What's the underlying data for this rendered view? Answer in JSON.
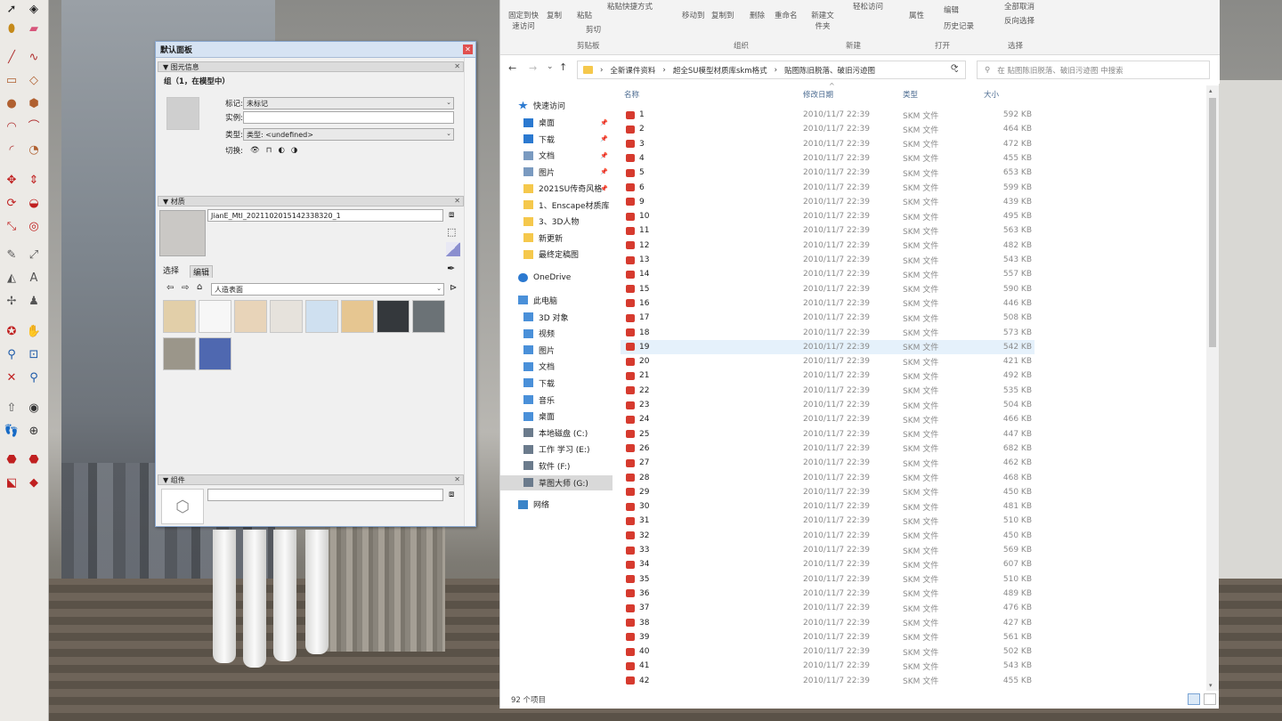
{
  "panel": {
    "title": "默认面板",
    "entity_info": {
      "header": "图元信息",
      "summary": "组（1，在模型中）",
      "tag_label": "标记:",
      "tag_value": "未标记",
      "instance_label": "实例:",
      "instance_value": "",
      "type_label": "类型:",
      "type_value": "类型: <undefined>",
      "toggle_label": "切换:"
    },
    "materials": {
      "header": "材质",
      "name_value": "JianE_Mtl_20211020151423383​20_1",
      "tab_select": "选择",
      "tab_edit": "编辑",
      "library_value": "人造表面",
      "swatch_colors": [
        "#e2cfa9",
        "#f7f7f7",
        "#e8d4b9",
        "#e6e2dc",
        "#cfe0f0",
        "#e6c691",
        "#34383c",
        "#6b7276",
        "#9b968a",
        "#4f68b0"
      ]
    },
    "components": {
      "header": "组件"
    }
  },
  "explorer": {
    "ribbon": {
      "pin_label": "固定到快速访问",
      "copy_label": "复制",
      "paste_label": "粘贴",
      "paste_shortcut_label": "粘贴快捷方式",
      "cut_label": "剪切",
      "clipboard_group": "剪贴板",
      "move_to_label": "移动到",
      "copy_to_label": "复制到",
      "delete_label": "删除",
      "rename_label": "重命名",
      "organize_group": "组织",
      "new_folder_label": "新建文件夹",
      "easy_access_label": "轻松访问",
      "new_group": "新建",
      "properties_label": "属性",
      "edit_label": "编辑",
      "history_label": "历史记录",
      "open_group": "打开",
      "select_all_label": "全部取消",
      "invert_label": "反向选择",
      "select_group": "选择"
    },
    "address": {
      "crumbs": [
        "全新课件资料",
        "超全SU模型材质库skm格式",
        "贴图陈旧脱落、破旧污迹图"
      ],
      "search_placeholder": "在 贴图陈旧脱落、破旧污迹图 中搜索"
    },
    "nav": {
      "quick_access": "快速访问",
      "items_quick": [
        "桌面",
        "下载",
        "文档",
        "图片",
        "2021SU传奇风格",
        "1、Enscape材质库",
        "3、3D人物",
        "新更新",
        "最终定稿图"
      ],
      "onedrive": "OneDrive",
      "this_pc": "此电脑",
      "items_pc": [
        "3D 对象",
        "视频",
        "图片",
        "文档",
        "下载",
        "音乐",
        "桌面",
        "本地磁盘 (C:)",
        "工作 学习 (E:)",
        "软件 (F:)",
        "草图大师 (G:)"
      ],
      "network": "网络"
    },
    "columns": {
      "name": "名称",
      "date": "修改日期",
      "type": "类型",
      "size": "大小"
    },
    "files": [
      {
        "name": "1",
        "date": "2010/11/7 22:39",
        "type": "SKM 文件",
        "size": "592 KB"
      },
      {
        "name": "2",
        "date": "2010/11/7 22:39",
        "type": "SKM 文件",
        "size": "464 KB"
      },
      {
        "name": "3",
        "date": "2010/11/7 22:39",
        "type": "SKM 文件",
        "size": "472 KB"
      },
      {
        "name": "4",
        "date": "2010/11/7 22:39",
        "type": "SKM 文件",
        "size": "455 KB"
      },
      {
        "name": "5",
        "date": "2010/11/7 22:39",
        "type": "SKM 文件",
        "size": "653 KB"
      },
      {
        "name": "6",
        "date": "2010/11/7 22:39",
        "type": "SKM 文件",
        "size": "599 KB"
      },
      {
        "name": "9",
        "date": "2010/11/7 22:39",
        "type": "SKM 文件",
        "size": "439 KB"
      },
      {
        "name": "10",
        "date": "2010/11/7 22:39",
        "type": "SKM 文件",
        "size": "495 KB"
      },
      {
        "name": "11",
        "date": "2010/11/7 22:39",
        "type": "SKM 文件",
        "size": "563 KB"
      },
      {
        "name": "12",
        "date": "2010/11/7 22:39",
        "type": "SKM 文件",
        "size": "482 KB"
      },
      {
        "name": "13",
        "date": "2010/11/7 22:39",
        "type": "SKM 文件",
        "size": "543 KB"
      },
      {
        "name": "14",
        "date": "2010/11/7 22:39",
        "type": "SKM 文件",
        "size": "557 KB"
      },
      {
        "name": "15",
        "date": "2010/11/7 22:39",
        "type": "SKM 文件",
        "size": "590 KB"
      },
      {
        "name": "16",
        "date": "2010/11/7 22:39",
        "type": "SKM 文件",
        "size": "446 KB"
      },
      {
        "name": "17",
        "date": "2010/11/7 22:39",
        "type": "SKM 文件",
        "size": "508 KB"
      },
      {
        "name": "18",
        "date": "2010/11/7 22:39",
        "type": "SKM 文件",
        "size": "573 KB"
      },
      {
        "name": "19",
        "date": "2010/11/7 22:39",
        "type": "SKM 文件",
        "size": "542 KB",
        "selected": true
      },
      {
        "name": "20",
        "date": "2010/11/7 22:39",
        "type": "SKM 文件",
        "size": "421 KB"
      },
      {
        "name": "21",
        "date": "2010/11/7 22:39",
        "type": "SKM 文件",
        "size": "492 KB"
      },
      {
        "name": "22",
        "date": "2010/11/7 22:39",
        "type": "SKM 文件",
        "size": "535 KB"
      },
      {
        "name": "23",
        "date": "2010/11/7 22:39",
        "type": "SKM 文件",
        "size": "504 KB"
      },
      {
        "name": "24",
        "date": "2010/11/7 22:39",
        "type": "SKM 文件",
        "size": "466 KB"
      },
      {
        "name": "25",
        "date": "2010/11/7 22:39",
        "type": "SKM 文件",
        "size": "447 KB"
      },
      {
        "name": "26",
        "date": "2010/11/7 22:39",
        "type": "SKM 文件",
        "size": "682 KB"
      },
      {
        "name": "27",
        "date": "2010/11/7 22:39",
        "type": "SKM 文件",
        "size": "462 KB"
      },
      {
        "name": "28",
        "date": "2010/11/7 22:39",
        "type": "SKM 文件",
        "size": "468 KB"
      },
      {
        "name": "29",
        "date": "2010/11/7 22:39",
        "type": "SKM 文件",
        "size": "450 KB"
      },
      {
        "name": "30",
        "date": "2010/11/7 22:39",
        "type": "SKM 文件",
        "size": "481 KB"
      },
      {
        "name": "31",
        "date": "2010/11/7 22:39",
        "type": "SKM 文件",
        "size": "510 KB"
      },
      {
        "name": "32",
        "date": "2010/11/7 22:39",
        "type": "SKM 文件",
        "size": "450 KB"
      },
      {
        "name": "33",
        "date": "2010/11/7 22:39",
        "type": "SKM 文件",
        "size": "569 KB"
      },
      {
        "name": "34",
        "date": "2010/11/7 22:39",
        "type": "SKM 文件",
        "size": "607 KB"
      },
      {
        "name": "35",
        "date": "2010/11/7 22:39",
        "type": "SKM 文件",
        "size": "510 KB"
      },
      {
        "name": "36",
        "date": "2010/11/7 22:39",
        "type": "SKM 文件",
        "size": "489 KB"
      },
      {
        "name": "37",
        "date": "2010/11/7 22:39",
        "type": "SKM 文件",
        "size": "476 KB"
      },
      {
        "name": "38",
        "date": "2010/11/7 22:39",
        "type": "SKM 文件",
        "size": "427 KB"
      },
      {
        "name": "39",
        "date": "2010/11/7 22:39",
        "type": "SKM 文件",
        "size": "561 KB"
      },
      {
        "name": "40",
        "date": "2010/11/7 22:39",
        "type": "SKM 文件",
        "size": "502 KB"
      },
      {
        "name": "41",
        "date": "2010/11/7 22:39",
        "type": "SKM 文件",
        "size": "543 KB"
      },
      {
        "name": "42",
        "date": "2010/11/7 22:39",
        "type": "SKM 文件",
        "size": "455 KB"
      }
    ],
    "status": "92 个项目"
  },
  "colors": {
    "selection": "#e5f1fb",
    "skm_icon": "#d63a2e",
    "folder": "#f5c84c",
    "accent_blue": "#2b79d0"
  }
}
